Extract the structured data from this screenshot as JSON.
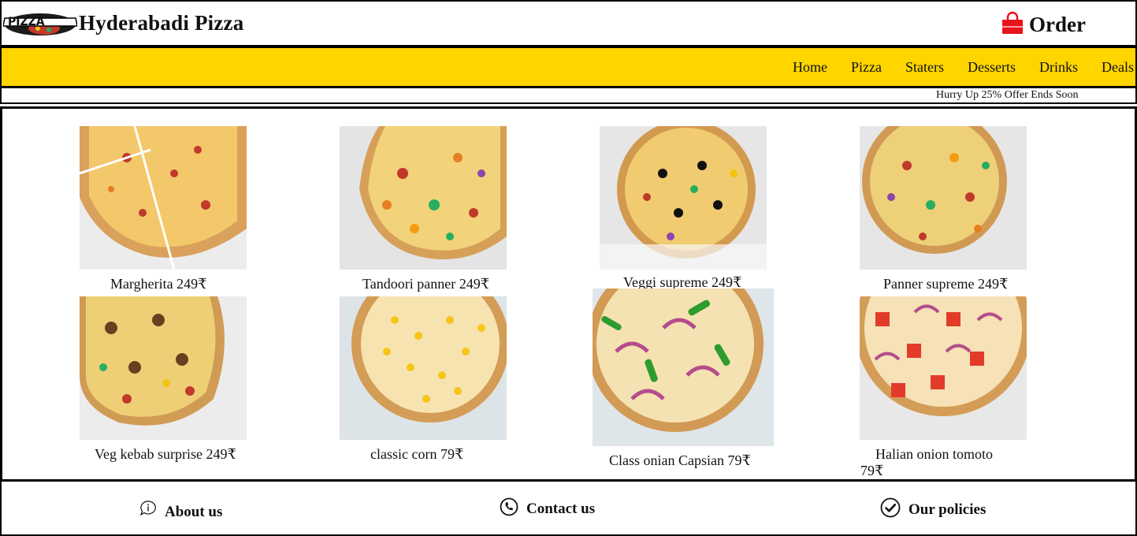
{
  "header": {
    "logo_text": "PIZZA",
    "brand": "Hyderabadi Pizza",
    "order_label": "Order"
  },
  "nav": {
    "items": [
      "Home",
      "Pizza",
      "Staters",
      "Desserts",
      "Drinks",
      "Deals"
    ]
  },
  "offer": {
    "text": "Hurry Up 25% Offer Ends Soon"
  },
  "products": [
    {
      "name": "Margherita 249₹"
    },
    {
      "name": "Tandoori panner 249₹"
    },
    {
      "name": "Veggi supreme 249₹"
    },
    {
      "name": "Panner supreme 249₹"
    },
    {
      "name": "Veg kebab surprise 249₹"
    },
    {
      "name": "classic corn 79₹"
    },
    {
      "name": "Class onian Capsian 79₹"
    },
    {
      "name_line1": "Halian onion tomoto",
      "name_line2": "79₹"
    }
  ],
  "footer": {
    "about": "About us",
    "contact": "Contact us",
    "policies": "Our policies"
  },
  "colors": {
    "nav_bg": "#ffd500",
    "order_bag": "#e8131b"
  },
  "icons": {
    "order": "shopping-bag-icon",
    "about": "info-chat-icon",
    "contact": "phone-icon",
    "policies": "check-circle-icon"
  }
}
